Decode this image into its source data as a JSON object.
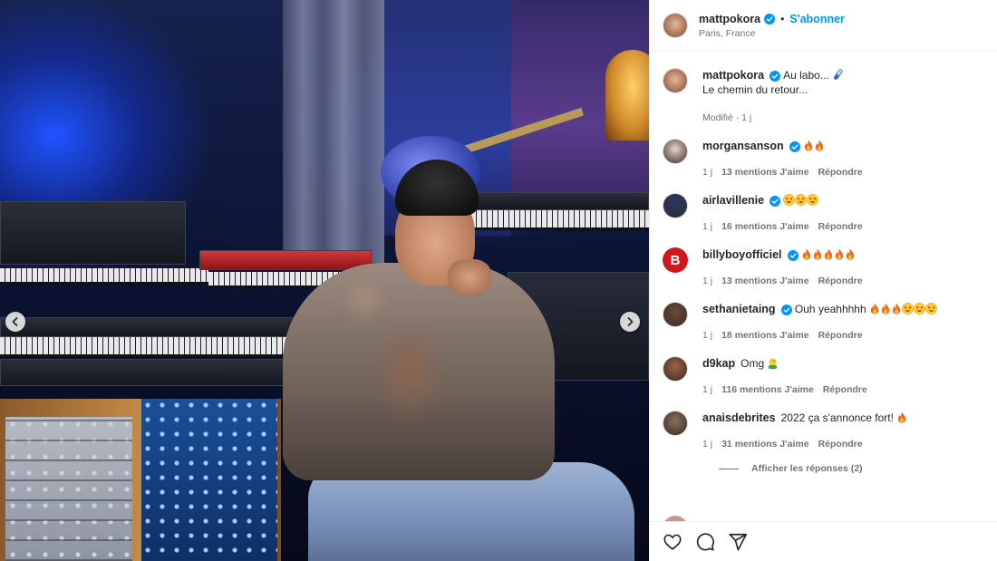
{
  "post": {
    "author": "mattpokora",
    "follow_label": "S'abonner",
    "location": "Paris, France",
    "caption_line1": "Au labo...",
    "caption_line2": "Le chemin du retour...",
    "caption_meta": "Modifié · 1 j"
  },
  "comments": [
    {
      "user": "morgansanson",
      "verified": true,
      "text": "",
      "emoji": [
        "fire",
        "fire"
      ],
      "time": "1 j",
      "likes": "13 mentions J'aime",
      "reply": "Répondre",
      "avatar_color": "#e8d5cc"
    },
    {
      "user": "airlavillenie",
      "verified": true,
      "text": "",
      "emoji": [
        "starstruck",
        "starstruck",
        "starstruck"
      ],
      "time": "1 j",
      "likes": "16 mentions J'aime",
      "reply": "Répondre",
      "avatar_color": "#1f3a6a"
    },
    {
      "user": "billyboyofficiel",
      "verified": true,
      "text": "",
      "emoji": [
        "fire",
        "fire",
        "fire",
        "fire",
        "fire"
      ],
      "time": "1 j",
      "likes": "13 mentions J'aime",
      "reply": "Répondre",
      "avatar_color": "#d0171d",
      "avatar_letter": "B"
    },
    {
      "user": "sethanietaing",
      "verified": true,
      "text": "Ouh yeahhhhh",
      "emoji": [
        "fire",
        "fire",
        "fire",
        "starstruck",
        "starstruck",
        "starstruck"
      ],
      "time": "1 j",
      "likes": "18 mentions J'aime",
      "reply": "Répondre",
      "avatar_color": "#6b4a3a"
    },
    {
      "user": "d9kap",
      "verified": false,
      "text": "Omg",
      "emoji": [
        "facepalm"
      ],
      "time": "1 j",
      "likes": "116 mentions J'aime",
      "reply": "Répondre",
      "avatar_color": "#a06048"
    },
    {
      "user": "anaisdebrites",
      "verified": false,
      "text": "2022 ça s'annonce fort!",
      "emoji": [
        "fire"
      ],
      "time": "1 j",
      "likes": "31 mentions J'aime",
      "reply": "Répondre",
      "avatar_color": "#8a7060"
    }
  ],
  "view_replies": "Afficher les réponses (2)",
  "colors": {
    "link_blue": "#0095f6",
    "verified_blue": "#0095f6",
    "muted": "#737373",
    "text": "#262626"
  },
  "icons": [
    "heart-icon",
    "comment-icon",
    "share-icon",
    "chevron-left-icon",
    "chevron-right-icon",
    "verified-icon"
  ]
}
